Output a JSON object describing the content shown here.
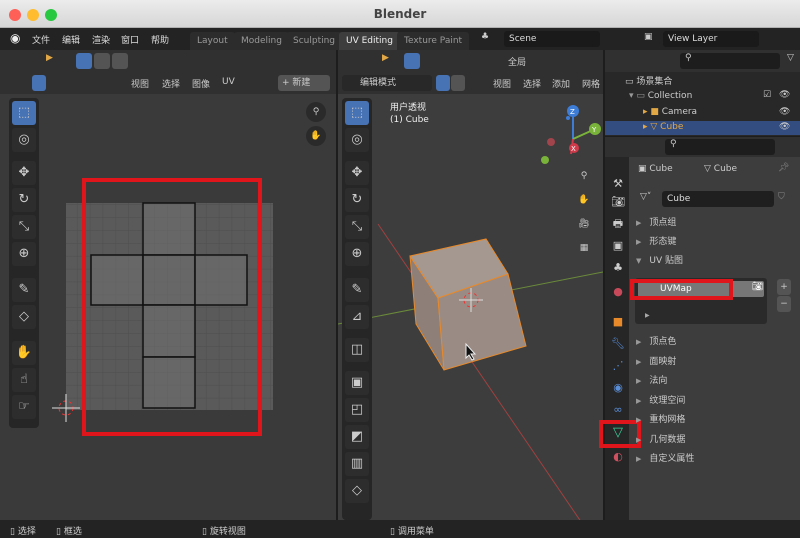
{
  "window": {
    "title": "Blender"
  },
  "menu": [
    "文件",
    "编辑",
    "渲染",
    "窗口",
    "帮助"
  ],
  "workspaces": [
    "Layout",
    "Modeling",
    "Sculpting",
    "UV Editing",
    "Texture Paint"
  ],
  "active_workspace": "UV Editing",
  "scene": "Scene",
  "view_layer": "View Layer",
  "uv_editor": {
    "menus": [
      "视图",
      "选择",
      "图像",
      "UV"
    ],
    "new_label": "新建"
  },
  "viewport": {
    "mode": "编辑模式",
    "transform": "全局",
    "menus": [
      "视图",
      "选择",
      "添加",
      "网格"
    ],
    "view_name": "用户透视",
    "object_label": "(1) Cube",
    "axes": {
      "x": "X",
      "y": "Y",
      "z": "Z"
    }
  },
  "outliner": {
    "items": [
      {
        "label": "场景集合"
      },
      {
        "label": "Collection"
      },
      {
        "label": "Camera"
      },
      {
        "label": "Cube"
      }
    ]
  },
  "properties": {
    "object_name": "Cube",
    "mesh_name": "Cube",
    "data_field": "Cube",
    "sections_top": [
      "顶点组",
      "形态键",
      "UV 贴图"
    ],
    "uv_map": "UVMap",
    "sections_bottom": [
      "顶点色",
      "面映射",
      "法向",
      "纹理空间",
      "重构网格",
      "几何数据",
      "自定义属性"
    ]
  },
  "status": [
    "选择",
    "框选",
    "旋转视图",
    "调用菜单"
  ],
  "colors": {
    "accent": "#4772b3",
    "highlight": "#e0141b",
    "mesh_icon": "#3bd09b"
  }
}
